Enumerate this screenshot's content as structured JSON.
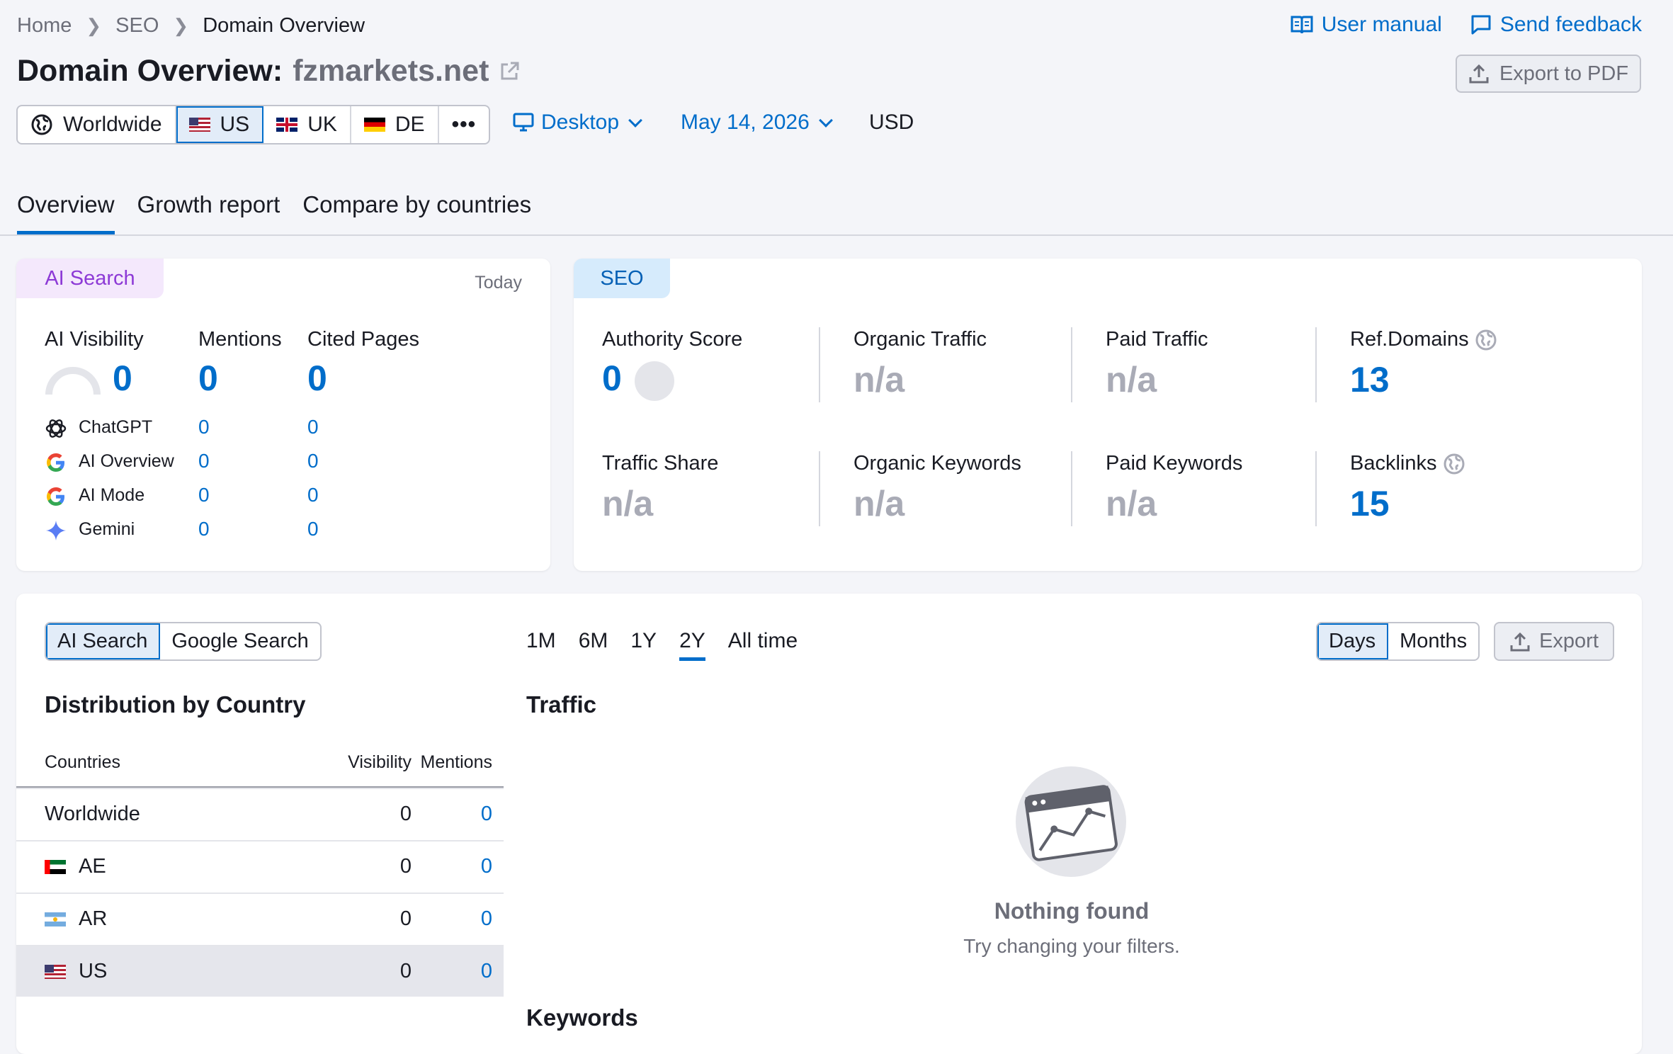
{
  "breadcrumbs": [
    "Home",
    "SEO",
    "Domain Overview"
  ],
  "header": {
    "title_prefix": "Domain Overview:",
    "domain": "fzmarkets.net",
    "user_manual": "User manual",
    "send_feedback": "Send feedback",
    "export_pdf": "Export to PDF"
  },
  "databases": [
    {
      "label": "Worldwide",
      "icon": "globe-icon",
      "selected": false
    },
    {
      "label": "US",
      "icon": "us-flag-icon",
      "selected": true
    },
    {
      "label": "UK",
      "icon": "uk-flag-icon",
      "selected": false
    },
    {
      "label": "DE",
      "icon": "de-flag-icon",
      "selected": false
    }
  ],
  "more_label": "•••",
  "device": "Desktop",
  "date": "May 14, 2026",
  "currency": "USD",
  "tabs": [
    "Overview",
    "Growth report",
    "Compare by countries"
  ],
  "ai_card": {
    "badge": "AI Search",
    "period": "Today",
    "headers": [
      "AI Visibility",
      "Mentions",
      "Cited Pages"
    ],
    "totals": [
      "0",
      "0",
      "0"
    ],
    "rows": [
      {
        "name": "ChatGPT",
        "icon": "chatgpt-icon",
        "mentions": "0",
        "cited": "0"
      },
      {
        "name": "AI Overview",
        "icon": "google-icon",
        "mentions": "0",
        "cited": "0"
      },
      {
        "name": "AI Mode",
        "icon": "google-icon",
        "mentions": "0",
        "cited": "0"
      },
      {
        "name": "Gemini",
        "icon": "gemini-icon",
        "mentions": "0",
        "cited": "0"
      }
    ]
  },
  "seo_card": {
    "badge": "SEO",
    "metrics": [
      {
        "label": "Authority Score",
        "value": "0"
      },
      {
        "label": "Organic Traffic",
        "value": "n/a"
      },
      {
        "label": "Paid Traffic",
        "value": "n/a"
      },
      {
        "label": "Ref.Domains",
        "value": "13"
      },
      {
        "label": "Traffic Share",
        "value": "n/a"
      },
      {
        "label": "Organic Keywords",
        "value": "n/a"
      },
      {
        "label": "Paid Keywords",
        "value": "n/a"
      },
      {
        "label": "Backlinks",
        "value": "15"
      }
    ]
  },
  "bottom": {
    "search_toggle": [
      "AI Search",
      "Google Search"
    ],
    "periods": [
      "1M",
      "6M",
      "1Y",
      "2Y",
      "All time"
    ],
    "active_period": "2Y",
    "granularity": [
      "Days",
      "Months"
    ],
    "export": "Export",
    "distribution_title": "Distribution by Country",
    "table_headers": [
      "Countries",
      "Visibility",
      "Mentions"
    ],
    "table_rows": [
      {
        "country": "Worldwide",
        "visibility": "0",
        "mentions": "0"
      },
      {
        "country": "AE",
        "visibility": "0",
        "mentions": "0"
      },
      {
        "country": "AR",
        "visibility": "0",
        "mentions": "0"
      },
      {
        "country": "US",
        "visibility": "0",
        "mentions": "0"
      }
    ],
    "traffic_title": "Traffic",
    "empty_title": "Nothing found",
    "empty_subtitle": "Try changing your filters.",
    "keywords_title": "Keywords"
  }
}
